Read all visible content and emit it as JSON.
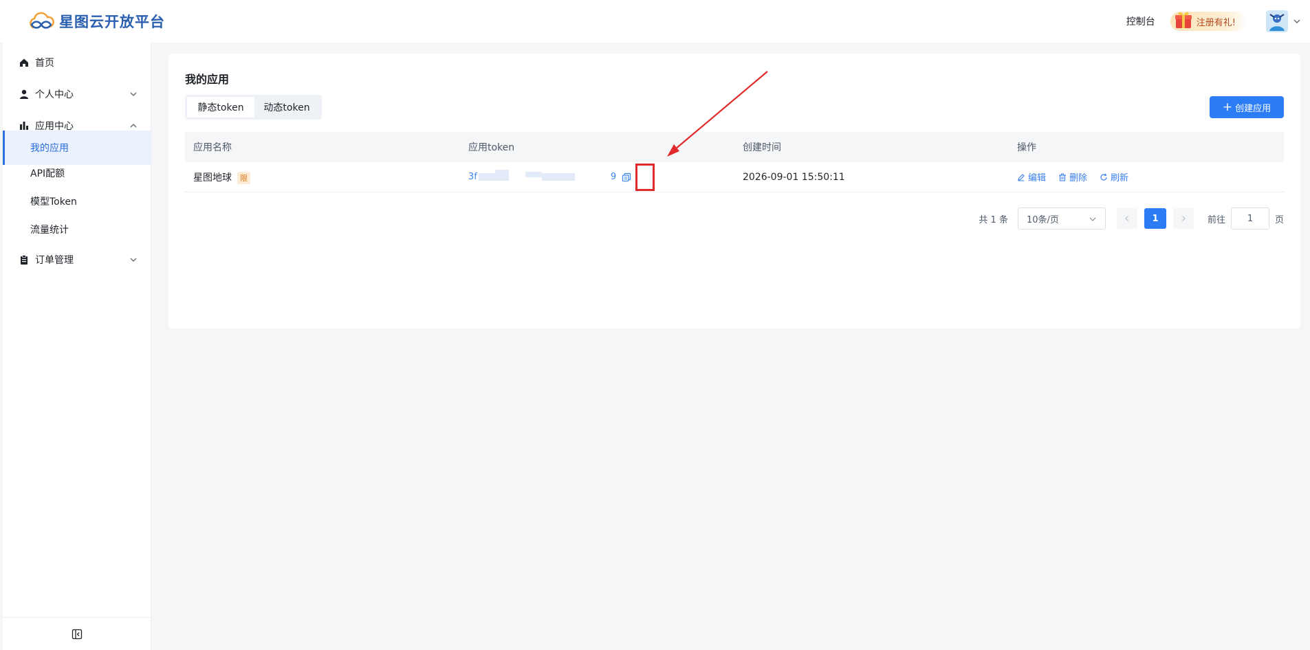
{
  "header": {
    "logo_text": "星图云开放平台",
    "console_label": "控制台",
    "promo_label": "注册有礼!",
    "accent": "#2a5fb0"
  },
  "sidebar": {
    "home": "首页",
    "personal_center": "个人中心",
    "app_center": "应用中心",
    "sub_items": [
      "我的应用",
      "API配额",
      "模型Token",
      "流量统计"
    ],
    "order_management": "订单管理"
  },
  "main": {
    "title": "我的应用",
    "tabs": [
      "静态token",
      "动态token"
    ],
    "create_button": "创建应用",
    "table": {
      "headers": [
        "应用名称",
        "应用token",
        "创建时间",
        "操作"
      ],
      "rows": [
        {
          "name": "星图地球",
          "badge": "限",
          "token_prefix": "3f",
          "token_suffix": "9",
          "created": "2026-09-01 15:50:11",
          "actions": [
            "编辑",
            "删除",
            "刷新"
          ]
        }
      ]
    },
    "pagination": {
      "total": "共 1 条",
      "page_size": "10条/页",
      "current_page": "1",
      "goto_label": "前往",
      "goto_value": "1",
      "page_suffix": "页"
    }
  },
  "colors": {
    "primary": "#2b7cf5",
    "active_bg": "#ebf2fe",
    "highlight_border": "#e02a2a"
  }
}
